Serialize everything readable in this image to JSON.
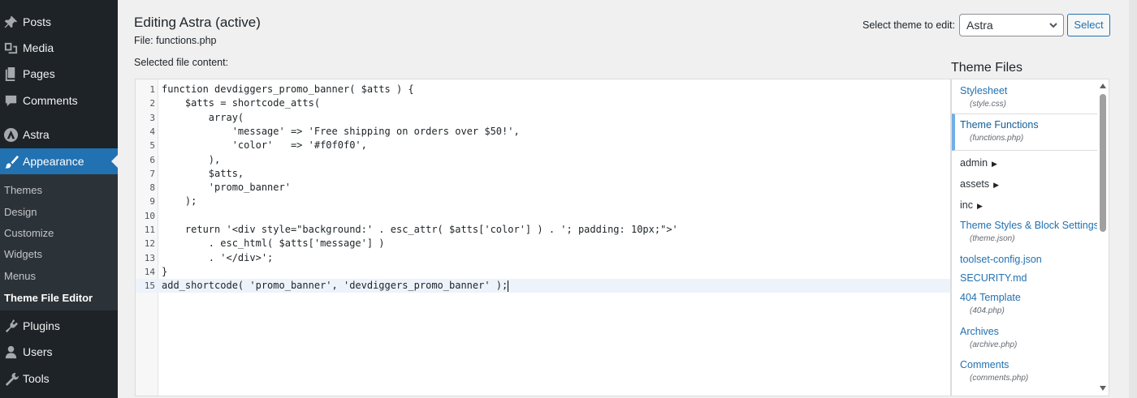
{
  "sidebar": {
    "items": [
      {
        "label": "Posts",
        "icon": "pin-icon"
      },
      {
        "label": "Media",
        "icon": "media-icon"
      },
      {
        "label": "Pages",
        "icon": "pages-icon"
      },
      {
        "label": "Comments",
        "icon": "comment-icon"
      },
      {
        "label": "Astra",
        "icon": "astra-logo-icon"
      },
      {
        "label": "Appearance",
        "icon": "paintbrush-icon"
      },
      {
        "label": "Plugins",
        "icon": "plug-icon"
      },
      {
        "label": "Users",
        "icon": "user-icon"
      },
      {
        "label": "Tools",
        "icon": "wrench-icon"
      }
    ],
    "submenu": [
      "Themes",
      "Design",
      "Customize",
      "Widgets",
      "Menus",
      "Theme File Editor"
    ],
    "accent_color": "#2271b1",
    "bg_color": "#1d2327"
  },
  "header": {
    "title": "Editing Astra (active)",
    "file_label": "File:",
    "file_name": "functions.php",
    "selected_label": "Selected file content:",
    "theme_select_label": "Select theme to edit:",
    "theme_select_value": "Astra",
    "select_button": "Select"
  },
  "editor": {
    "lines": [
      {
        "n": "1",
        "code": "function devdiggers_promo_banner( $atts ) {"
      },
      {
        "n": "2",
        "code": "    $atts = shortcode_atts("
      },
      {
        "n": "3",
        "code": "        array("
      },
      {
        "n": "4",
        "code": "            'message' => 'Free shipping on orders over $50!',"
      },
      {
        "n": "5",
        "code": "            'color'   => '#f0f0f0',"
      },
      {
        "n": "6",
        "code": "        ),"
      },
      {
        "n": "7",
        "code": "        $atts,"
      },
      {
        "n": "8",
        "code": "        'promo_banner'"
      },
      {
        "n": "9",
        "code": "    );"
      },
      {
        "n": "10",
        "code": ""
      },
      {
        "n": "11",
        "code": "    return '<div style=\"background:' . esc_attr( $atts['color'] ) . '; padding: 10px;\">'"
      },
      {
        "n": "12",
        "code": "        . esc_html( $atts['message'] )"
      },
      {
        "n": "13",
        "code": "        . '</div>';"
      },
      {
        "n": "14",
        "code": "}"
      },
      {
        "n": "15",
        "code": "add_shortcode( 'promo_banner', 'devdiggers_promo_banner' );"
      }
    ],
    "active_line": 15
  },
  "files": {
    "title": "Theme Files",
    "entries": [
      {
        "name": "Stylesheet",
        "sub": "(style.css)"
      },
      {
        "name": "Theme Functions",
        "sub": "(functions.php)"
      },
      {
        "name": "admin"
      },
      {
        "name": "assets"
      },
      {
        "name": "inc"
      },
      {
        "name": "Theme Styles & Block Settings",
        "sub": "(theme.json)"
      },
      {
        "name": "toolset-config.json"
      },
      {
        "name": "SECURITY.md"
      },
      {
        "name": "404 Template",
        "sub": "(404.php)"
      },
      {
        "name": "Archives",
        "sub": "(archive.php)"
      },
      {
        "name": "Comments",
        "sub": "(comments.php)"
      }
    ]
  }
}
